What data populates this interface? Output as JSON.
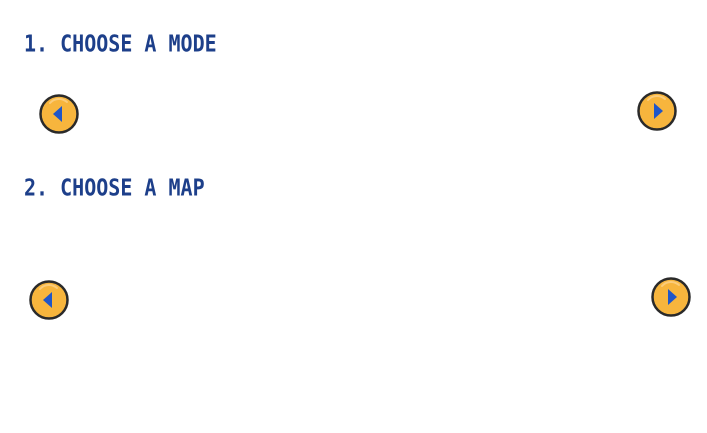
{
  "colors": {
    "title": "#1d3f8a",
    "button_fill": "#f7b53d",
    "button_border": "#2a2a2a",
    "arrow": "#1f56c9"
  },
  "mode_section": {
    "title": "1. CHOOSE A MODE",
    "prev_icon": "arrow-left-icon",
    "next_icon": "arrow-right-icon"
  },
  "map_section": {
    "title": "2. CHOOSE A MAP",
    "prev_icon": "arrow-left-icon",
    "next_icon": "arrow-right-icon"
  }
}
